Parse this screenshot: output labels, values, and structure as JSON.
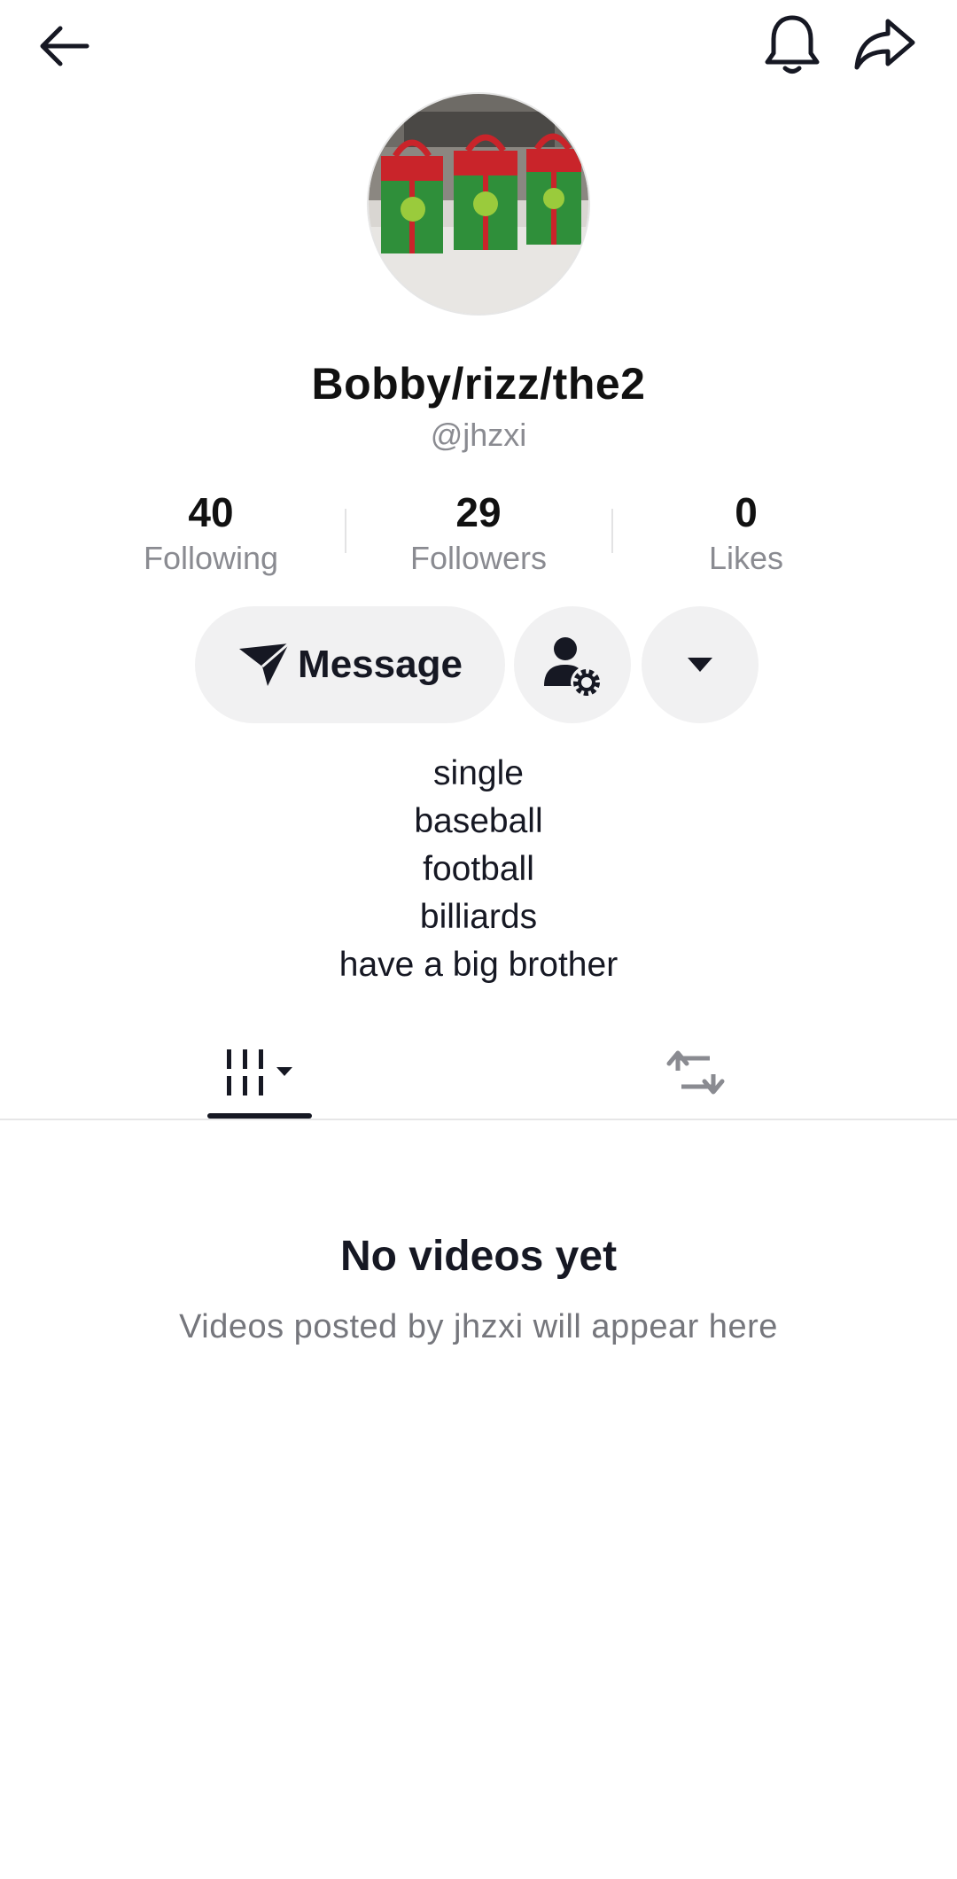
{
  "header": {
    "back_icon": "arrow-left-icon",
    "bell_icon": "bell-icon",
    "share_icon": "share-arrow-icon"
  },
  "profile": {
    "display_name": "Bobby/rizz/the2",
    "handle": "@jhzxi",
    "avatar_description": "avatar-photo"
  },
  "stats": [
    {
      "value": "40",
      "label": "Following"
    },
    {
      "value": "29",
      "label": "Followers"
    },
    {
      "value": "0",
      "label": "Likes"
    }
  ],
  "actions": {
    "message_label": "Message",
    "message_icon": "send-plane-icon",
    "friend_settings_icon": "person-gear-icon",
    "more_icon": "caret-down-icon",
    "button_bg": "#f1f1f2"
  },
  "bio": {
    "lines": [
      "single",
      "baseball",
      "football",
      "billiards",
      "have a big brother"
    ]
  },
  "tabs": {
    "videos_icon": "videos-grid-icon",
    "reposts_icon": "repost-icon",
    "active": "videos"
  },
  "empty_state": {
    "title": "No videos yet",
    "subtitle": "Videos posted by jhzxi will appear here"
  },
  "colors": {
    "text_primary": "#161823",
    "text_secondary": "#8a8b91"
  }
}
